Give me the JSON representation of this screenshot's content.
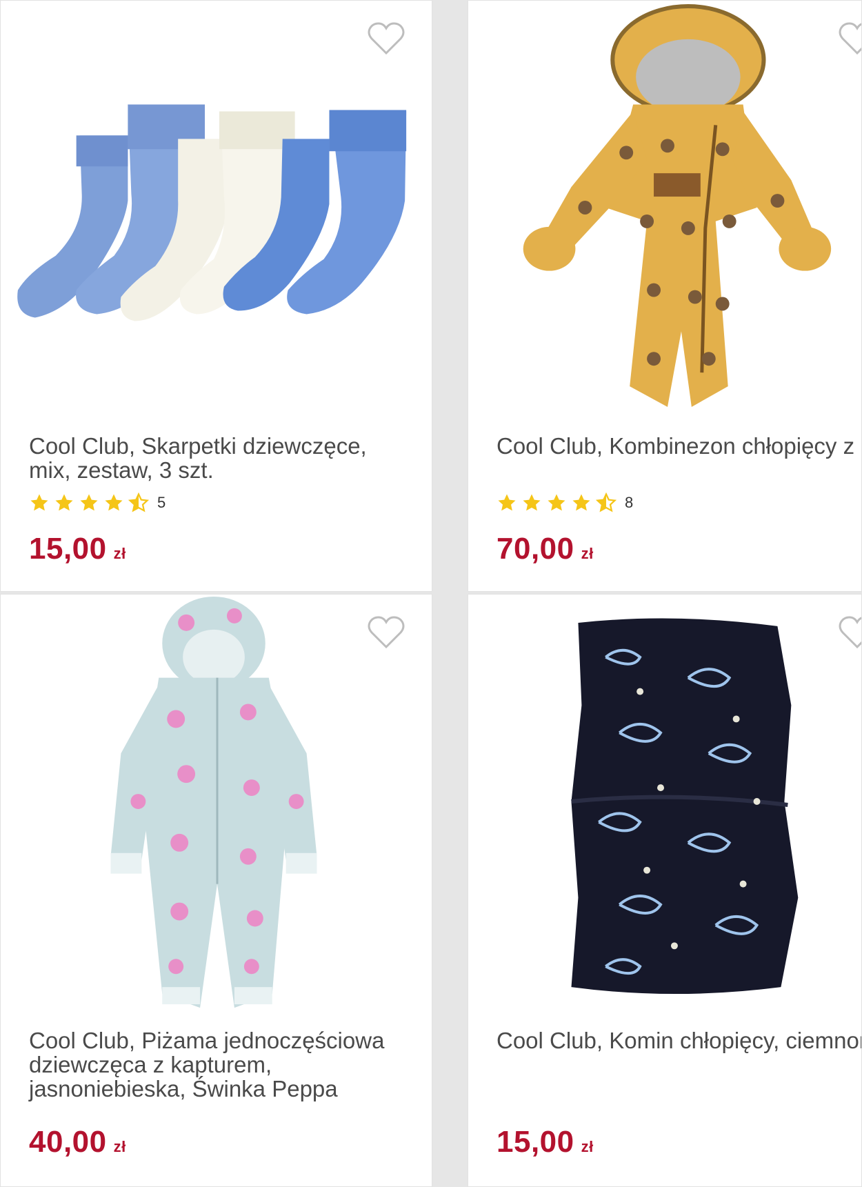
{
  "products": [
    {
      "title": "Cool Club, Skarpetki dziewczęce,\nmix, zestaw, 3 szt.",
      "rating_count": "5",
      "rating_value": 4.5,
      "price": "15,00",
      "currency": "zł",
      "icon": "heart-outline-icon"
    },
    {
      "title": "Cool Club, Kombinezon chłopięcy z\nkapturem, żółty",
      "rating_count": "8",
      "rating_value": 4.5,
      "price": "70,00",
      "currency": "zł",
      "icon": "heart-outline-icon"
    },
    {
      "title": "Cool Club, Piżama jednoczęściowa\ndziewczęca z kapturem,\njasnoniebieska, Świnka Peppa",
      "price": "40,00",
      "currency": "zł",
      "icon": "heart-outline-icon"
    },
    {
      "title": "Cool Club, Komin chłopięcy,\nciemnoniebieski",
      "price": "15,00",
      "currency": "zł",
      "icon": "heart-outline-icon"
    }
  ],
  "colors": {
    "price": "#b3122e",
    "star": "#f5c518",
    "heart": "#bdbdbd"
  }
}
